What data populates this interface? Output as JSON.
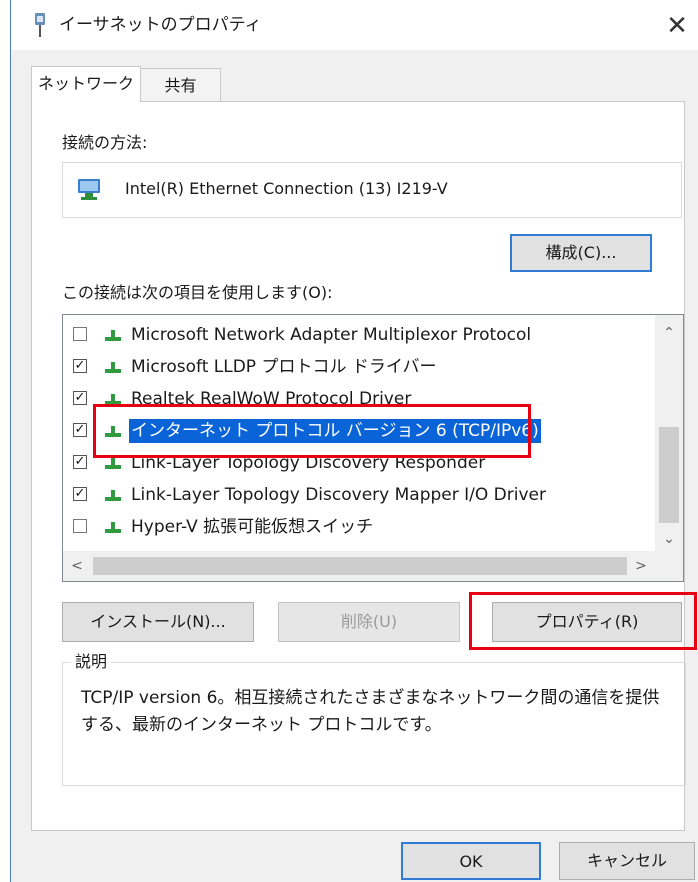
{
  "window": {
    "title": "イーサネットのプロパティ",
    "close_glyph": "✕"
  },
  "tabs": [
    {
      "label": "ネットワーク",
      "active": true
    },
    {
      "label": "共有",
      "active": false
    }
  ],
  "connection": {
    "label": "接続の方法:",
    "adapter_name": "Intel(R) Ethernet Connection (13) I219-V",
    "configure_button": "構成(C)..."
  },
  "items_section": {
    "label": "この接続は次の項目を使用します(O):",
    "items": [
      {
        "label": "Microsoft Network Adapter Multiplexor Protocol",
        "checked": false,
        "check_glyph": ""
      },
      {
        "label": "Microsoft LLDP プロトコル ドライバー",
        "checked": true,
        "check_glyph": "✓"
      },
      {
        "label": "Realtek RealWoW Protocol Driver",
        "checked": true,
        "check_glyph": "✓"
      },
      {
        "label": "インターネット プロトコル バージョン 6 (TCP/IPv6)",
        "checked": true,
        "check_glyph": "✓",
        "selected": true
      },
      {
        "label": "Link-Layer Topology Discovery Responder",
        "checked": true,
        "check_glyph": "✓"
      },
      {
        "label": "Link-Layer Topology Discovery Mapper I/O Driver",
        "checked": true,
        "check_glyph": "✓"
      },
      {
        "label": "Hyper-V 拡張可能仮想スイッチ",
        "checked": false,
        "check_glyph": ""
      }
    ],
    "scroll_up": "⌃",
    "scroll_down": "⌄",
    "scroll_left": "<",
    "scroll_right": ">"
  },
  "action_buttons": {
    "install": "インストール(N)...",
    "uninstall": "削除(U)",
    "properties": "プロパティ(R)"
  },
  "description": {
    "legend": "説明",
    "text": "TCP/IP version 6。相互接続されたさまざまなネットワーク間の通信を提供する、最新のインターネット プロトコルです。"
  },
  "footer": {
    "ok": "OK",
    "cancel": "キャンセル"
  },
  "colors": {
    "selection": "#0a64d8",
    "highlight_box": "#e60012",
    "default_button_border": "#2f7bd6"
  },
  "icons": {
    "title": "network-cable-icon",
    "adapter": "network-adapter-icon",
    "protocol": "protocol-icon"
  }
}
